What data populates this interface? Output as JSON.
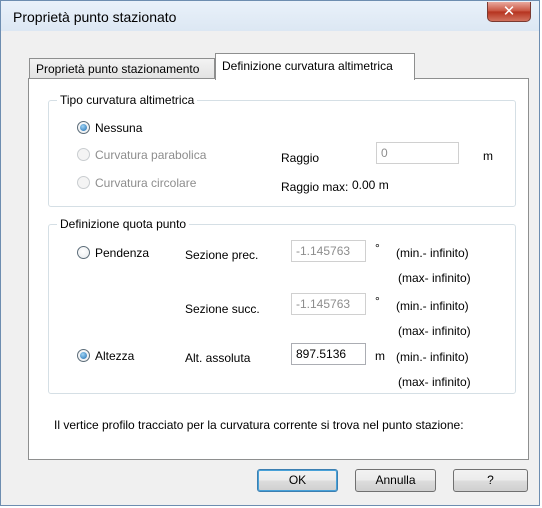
{
  "window": {
    "title": "Proprietà punto stazionato",
    "close_glyph": "✕"
  },
  "tabs": [
    {
      "label": "Proprietà punto stazionamento",
      "active": false
    },
    {
      "label": "Definizione curvatura altimetrica",
      "active": true
    }
  ],
  "curvature_group": {
    "title": "Tipo curvatura altimetrica",
    "options": [
      {
        "label": "Nessuna",
        "checked": true,
        "enabled": true
      },
      {
        "label": "Curvatura parabolica",
        "checked": false,
        "enabled": false
      },
      {
        "label": "Curvatura circolare",
        "checked": false,
        "enabled": false
      }
    ],
    "raggio_label": "Raggio",
    "raggio_value": "0",
    "raggio_unit": "m",
    "raggio_max_label": "Raggio max:",
    "raggio_max_value": "0.00 m"
  },
  "quota_group": {
    "title": "Definizione quota punto",
    "pendenza_label": "Pendenza",
    "sezione_prec_label": "Sezione prec.",
    "sezione_prec_value": "-1.145763",
    "sezione_prec_unit": "°",
    "sezione_prec_min": "(min.- infinito)",
    "sezione_prec_max": "(max- infinito)",
    "sezione_succ_label": "Sezione succ.",
    "sezione_succ_value": "-1.145763",
    "sezione_succ_unit": "°",
    "sezione_succ_min": "(min.- infinito)",
    "sezione_succ_max": "(max- infinito)",
    "altezza_label": "Altezza",
    "alt_assoluta_label": "Alt. assoluta",
    "alt_assoluta_value": "897.5136",
    "alt_assoluta_unit": "m",
    "alt_min": "(min.- infinito)",
    "alt_max": "(max- infinito)"
  },
  "footer_note": "Il vertice profilo tracciato per la curvatura corrente si trova nel punto stazione:",
  "buttons": {
    "ok": "OK",
    "annulla": "Annulla",
    "help": "?"
  }
}
